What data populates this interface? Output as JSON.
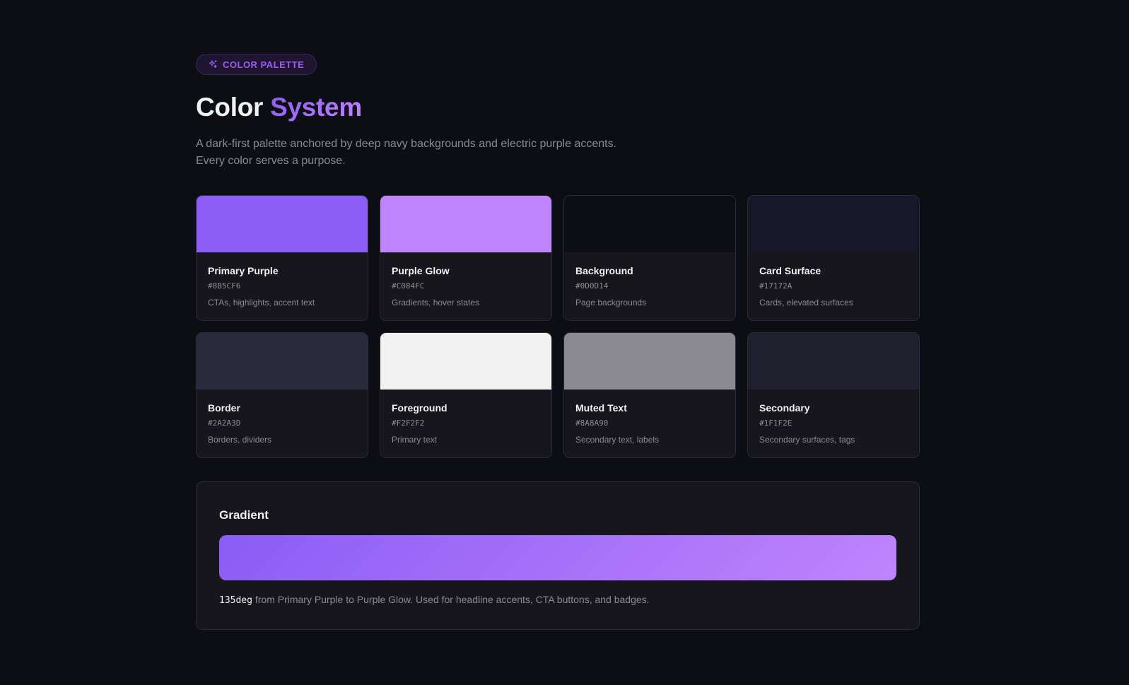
{
  "header": {
    "badge_label": "COLOR PALETTE",
    "badge_icon": "sparkle-icon",
    "title_main": "Color",
    "title_accent": "System",
    "subtitle_line1": "A dark-first palette anchored by deep navy backgrounds and electric purple accents.",
    "subtitle_line2": "Every color serves a purpose."
  },
  "colors": [
    {
      "name": "Primary Purple",
      "hex": "#8B5CF6",
      "usage": "CTAs, highlights, accent text",
      "swatch": "#8b5cf6"
    },
    {
      "name": "Purple Glow",
      "hex": "#C084FC",
      "usage": "Gradients, hover states",
      "swatch": "#c084fc"
    },
    {
      "name": "Background",
      "hex": "#0D0D14",
      "usage": "Page backgrounds",
      "swatch": "#0d0d14"
    },
    {
      "name": "Card Surface",
      "hex": "#17172A",
      "usage": "Cards, elevated surfaces",
      "swatch": "#17172a"
    },
    {
      "name": "Border",
      "hex": "#2A2A3D",
      "usage": "Borders, dividers",
      "swatch": "#2a2a3d"
    },
    {
      "name": "Foreground",
      "hex": "#F2F2F2",
      "usage": "Primary text",
      "swatch": "#f2f2f2"
    },
    {
      "name": "Muted Text",
      "hex": "#8A8A90",
      "usage": "Secondary text, labels",
      "swatch": "#8a8a90"
    },
    {
      "name": "Secondary",
      "hex": "#1F1F2E",
      "usage": "Secondary surfaces, tags",
      "swatch": "#1f1f2e"
    }
  ],
  "gradient": {
    "title": "Gradient",
    "angle": "135deg",
    "note": " from Primary Purple to Purple Glow. Used for headline accents, CTA buttons, and badges.",
    "from": "#8b5cf6",
    "to": "#c084fc"
  }
}
